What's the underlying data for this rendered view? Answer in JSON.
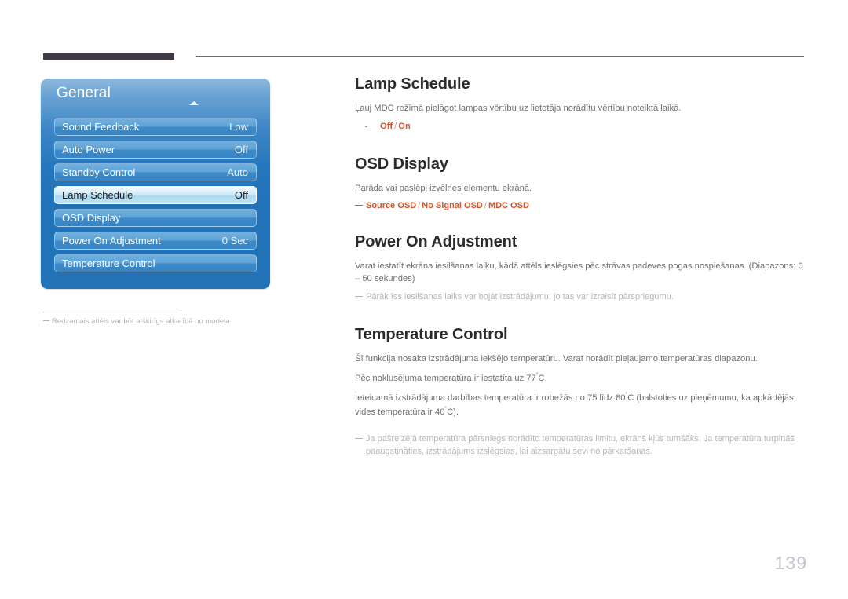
{
  "page": {
    "number": "139"
  },
  "osd": {
    "title": "General",
    "scroll_indicator": "up-arrow",
    "rows": [
      {
        "label": "Sound Feedback",
        "value": "Low",
        "selected": false
      },
      {
        "label": "Auto Power",
        "value": "Off",
        "selected": false
      },
      {
        "label": "Standby Control",
        "value": "Auto",
        "selected": false
      },
      {
        "label": "Lamp Schedule",
        "value": "Off",
        "selected": true
      },
      {
        "label": "OSD Display",
        "value": "",
        "selected": false
      },
      {
        "label": "Power On Adjustment",
        "value": "0 Sec",
        "selected": false
      },
      {
        "label": "Temperature Control",
        "value": "",
        "selected": false
      }
    ],
    "model_note": "Redzamais attēls var būt atšķirīgs atkarībā no modeļa."
  },
  "sections": {
    "lamp_schedule": {
      "heading": "Lamp Schedule",
      "body": "Ļauj MDC režīmā pielāgot lampas vērtību uz lietotāja norādītu vērtību noteiktā laikā.",
      "options": [
        {
          "text": "Off",
          "accent": true
        },
        {
          "text": "/",
          "accent": false
        },
        {
          "text": "On",
          "accent": true
        }
      ]
    },
    "osd_display": {
      "heading": "OSD Display",
      "body": "Parāda vai paslēpj izvēlnes elementu ekrānā.",
      "options": [
        {
          "text": "Source OSD",
          "accent": true
        },
        {
          "text": "/",
          "accent": false
        },
        {
          "text": "No Signal OSD",
          "accent": true
        },
        {
          "text": "/",
          "accent": false
        },
        {
          "text": "MDC OSD",
          "accent": true
        }
      ]
    },
    "power_on_adjustment": {
      "heading": "Power On Adjustment",
      "body": "Varat iestatīt ekrāna iesilšanas laiku, kādā attēls ieslēgsies pēc strāvas padeves pogas nospiešanas. (Diapazons: 0 – 50 sekundes)",
      "note": "Pārāk īss iesilšanas laiks var bojāt izstrādājumu, jo tas var izraisīt pārspriegumu."
    },
    "temperature_control": {
      "heading": "Temperature Control",
      "body1": "Šī funkcija nosaka izstrādājuma iekšējo temperatūru. Varat norādīt pieļaujamo temperatūras diapazonu.",
      "body2_pre": "Pēc noklusējuma temperatūra ir iestatīta uz 77",
      "body2_post": "C.",
      "body3_pre": "Ieteicamā izstrādājuma darbības temperatūra ir robežās no 75 līdz 80",
      "body3_mid": "C (balstoties uz pieņēmumu, ka apkārtējās vides temperatūra ir 40",
      "body3_post": "C).",
      "note": "Ja pašreizējā temperatūra pārsniegs norādīto temperatūras limitu, ekrāns kļūs tumšāks. Ja temperatūra turpinās paaugstināties, izstrādājums izslēgsies, lai aizsargātu sevi no pārkaršanas.",
      "degree_symbol": "˚"
    }
  },
  "colors": {
    "accent_orange": "#d4542b",
    "panel_blue": "#2272b8",
    "heading_dark": "#2b2b2b",
    "body_gray": "#6f6f6f",
    "note_gray": "#b6b6bd",
    "header_bar": "#403a47"
  }
}
